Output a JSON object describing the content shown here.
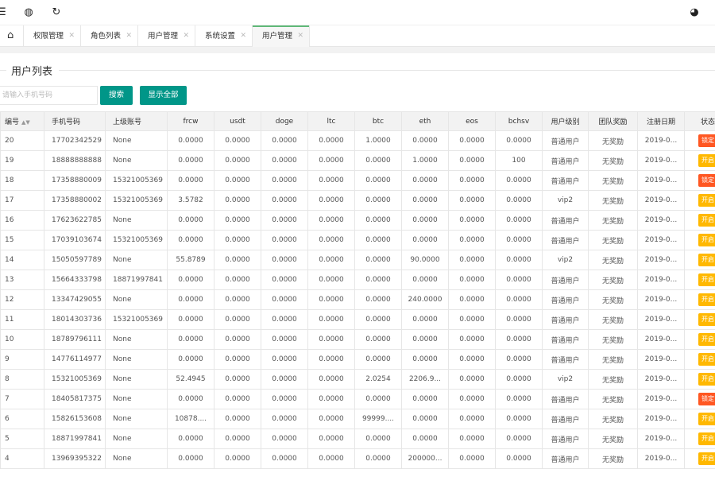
{
  "toolbar": {
    "menu_icon": "☰",
    "globe_icon": "◍",
    "refresh_icon": "↻",
    "theme_icon": "◕"
  },
  "tabs": {
    "home_icon": "⌂",
    "items": [
      {
        "label": "权限管理",
        "close": "✕"
      },
      {
        "label": "角色列表",
        "close": "✕"
      },
      {
        "label": "用户管理",
        "close": "✕"
      },
      {
        "label": "系统设置",
        "close": "✕"
      },
      {
        "label": "用户管理",
        "close": "✕"
      }
    ]
  },
  "section": {
    "title": "用户列表"
  },
  "search": {
    "placeholder": "请输入手机号码",
    "search_label": "搜索",
    "show_all_label": "显示全部"
  },
  "table": {
    "headers": [
      "编号",
      "手机号码",
      "上级账号",
      "frcw",
      "usdt",
      "doge",
      "ltc",
      "btc",
      "eth",
      "eos",
      "bchsv",
      "用户级别",
      "团队奖励",
      "注册日期",
      "状态"
    ],
    "sort_icon": "▲▼",
    "rows": [
      [
        "20",
        "17702342529",
        "None",
        "0.0000",
        "0.0000",
        "0.0000",
        "0.0000",
        "1.0000",
        "0.0000",
        "0.0000",
        "0.0000",
        "普通用户",
        "无奖励",
        "2019-0...",
        "锁定"
      ],
      [
        "19",
        "18888888888",
        "None",
        "0.0000",
        "0.0000",
        "0.0000",
        "0.0000",
        "0.0000",
        "1.0000",
        "0.0000",
        "100",
        "普通用户",
        "无奖励",
        "2019-0...",
        "开启"
      ],
      [
        "18",
        "17358880009",
        "15321005369",
        "0.0000",
        "0.0000",
        "0.0000",
        "0.0000",
        "0.0000",
        "0.0000",
        "0.0000",
        "0.0000",
        "普通用户",
        "无奖励",
        "2019-0...",
        "锁定"
      ],
      [
        "17",
        "17358880002",
        "15321005369",
        "3.5782",
        "0.0000",
        "0.0000",
        "0.0000",
        "0.0000",
        "0.0000",
        "0.0000",
        "0.0000",
        "vip2",
        "无奖励",
        "2019-0...",
        "开启"
      ],
      [
        "16",
        "17623622785",
        "None",
        "0.0000",
        "0.0000",
        "0.0000",
        "0.0000",
        "0.0000",
        "0.0000",
        "0.0000",
        "0.0000",
        "普通用户",
        "无奖励",
        "2019-0...",
        "开启"
      ],
      [
        "15",
        "17039103674",
        "15321005369",
        "0.0000",
        "0.0000",
        "0.0000",
        "0.0000",
        "0.0000",
        "0.0000",
        "0.0000",
        "0.0000",
        "普通用户",
        "无奖励",
        "2019-0...",
        "开启"
      ],
      [
        "14",
        "15050597789",
        "None",
        "55.8789",
        "0.0000",
        "0.0000",
        "0.0000",
        "0.0000",
        "90.0000",
        "0.0000",
        "0.0000",
        "vip2",
        "无奖励",
        "2019-0...",
        "开启"
      ],
      [
        "13",
        "15664333798",
        "18871997841",
        "0.0000",
        "0.0000",
        "0.0000",
        "0.0000",
        "0.0000",
        "0.0000",
        "0.0000",
        "0.0000",
        "普通用户",
        "无奖励",
        "2019-0...",
        "开启"
      ],
      [
        "12",
        "13347429055",
        "None",
        "0.0000",
        "0.0000",
        "0.0000",
        "0.0000",
        "0.0000",
        "240.0000",
        "0.0000",
        "0.0000",
        "普通用户",
        "无奖励",
        "2019-0...",
        "开启"
      ],
      [
        "11",
        "18014303736",
        "15321005369",
        "0.0000",
        "0.0000",
        "0.0000",
        "0.0000",
        "0.0000",
        "0.0000",
        "0.0000",
        "0.0000",
        "普通用户",
        "无奖励",
        "2019-0...",
        "开启"
      ],
      [
        "10",
        "18789796111",
        "None",
        "0.0000",
        "0.0000",
        "0.0000",
        "0.0000",
        "0.0000",
        "0.0000",
        "0.0000",
        "0.0000",
        "普通用户",
        "无奖励",
        "2019-0...",
        "开启"
      ],
      [
        "9",
        "14776114977",
        "None",
        "0.0000",
        "0.0000",
        "0.0000",
        "0.0000",
        "0.0000",
        "0.0000",
        "0.0000",
        "0.0000",
        "普通用户",
        "无奖励",
        "2019-0...",
        "开启"
      ],
      [
        "8",
        "15321005369",
        "None",
        "52.4945",
        "0.0000",
        "0.0000",
        "0.0000",
        "2.0254",
        "2206.9...",
        "0.0000",
        "0.0000",
        "vip2",
        "无奖励",
        "2019-0...",
        "开启"
      ],
      [
        "7",
        "18405817375",
        "None",
        "0.0000",
        "0.0000",
        "0.0000",
        "0.0000",
        "0.0000",
        "0.0000",
        "0.0000",
        "0.0000",
        "普通用户",
        "无奖励",
        "2019-0...",
        "锁定"
      ],
      [
        "6",
        "15826153608",
        "None",
        "10878....",
        "0.0000",
        "0.0000",
        "0.0000",
        "99999....",
        "0.0000",
        "0.0000",
        "0.0000",
        "普通用户",
        "无奖励",
        "2019-0...",
        "开启"
      ],
      [
        "5",
        "18871997841",
        "None",
        "0.0000",
        "0.0000",
        "0.0000",
        "0.0000",
        "0.0000",
        "0.0000",
        "0.0000",
        "0.0000",
        "普通用户",
        "无奖励",
        "2019-0...",
        "开启"
      ],
      [
        "4",
        "13969395322",
        "None",
        "0.0000",
        "0.0000",
        "0.0000",
        "0.0000",
        "0.0000",
        "200000...",
        "0.0000",
        "0.0000",
        "普通用户",
        "无奖励",
        "2019-0...",
        "开启"
      ]
    ]
  },
  "colors": {
    "primary": "#009688",
    "lock": "#ff5722",
    "open": "#ffb800",
    "tab_active_bar": "#5fb878"
  }
}
